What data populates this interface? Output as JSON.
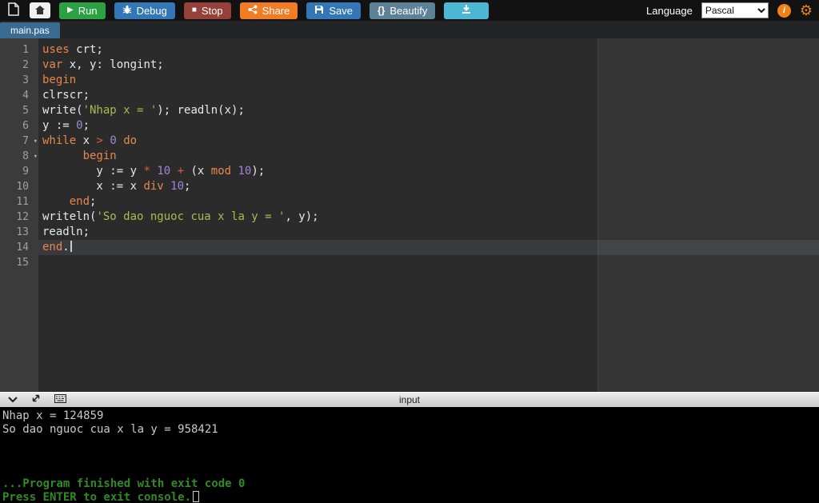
{
  "colors": {
    "run_button": "#2ba143",
    "debug_button": "#3377b6",
    "stop_button": "#95413a",
    "share_button": "#f07c24",
    "save_button": "#3377b6",
    "beautify_button": "#5d8196",
    "download_button": "#4cb8d5",
    "accent_orange": "#ef8318",
    "tab_active": "#3a6b93"
  },
  "toolbar": {
    "run": "Run",
    "debug": "Debug",
    "stop": "Stop",
    "share": "Share",
    "save": "Save",
    "beautify": "Beautify",
    "play_glyph": "▶",
    "stop_glyph": "■",
    "braces_glyph": "{}",
    "info_glyph": "i",
    "gear_glyph": "⚙",
    "language_label": "Language",
    "language_value": "Pascal"
  },
  "tabs": [
    {
      "label": "main.pas"
    }
  ],
  "editor": {
    "fold_glyph": "▾",
    "token_colors": {
      "kw": "#e8874a",
      "str": "#a8bc4f",
      "num": "#a184d9",
      "op": "#e8534a",
      "pl": "#e8e8ea"
    },
    "lines": [
      {
        "n": 1,
        "tokens": [
          [
            "kw",
            "uses"
          ],
          [
            "pl",
            " crt;"
          ]
        ]
      },
      {
        "n": 2,
        "tokens": [
          [
            "kw",
            "var"
          ],
          [
            "pl",
            " x, y: longint;"
          ]
        ]
      },
      {
        "n": 3,
        "tokens": [
          [
            "kw",
            "begin"
          ]
        ]
      },
      {
        "n": 4,
        "tokens": [
          [
            "pl",
            "clrscr;"
          ]
        ]
      },
      {
        "n": 5,
        "tokens": [
          [
            "pl",
            "write("
          ],
          [
            "str",
            "'Nhap x = '"
          ],
          [
            "pl",
            "); readln(x);"
          ]
        ]
      },
      {
        "n": 6,
        "tokens": [
          [
            "pl",
            "y := "
          ],
          [
            "num",
            "0"
          ],
          [
            "pl",
            ";"
          ]
        ]
      },
      {
        "n": 7,
        "fold": true,
        "tokens": [
          [
            "kw",
            "while"
          ],
          [
            "pl",
            " x "
          ],
          [
            "op",
            ">"
          ],
          [
            "pl",
            " "
          ],
          [
            "num",
            "0"
          ],
          [
            "pl",
            " "
          ],
          [
            "kw",
            "do"
          ]
        ]
      },
      {
        "n": 8,
        "fold": true,
        "tokens": [
          [
            "pl",
            "      "
          ],
          [
            "kw",
            "begin"
          ]
        ]
      },
      {
        "n": 9,
        "tokens": [
          [
            "pl",
            "        y := y "
          ],
          [
            "op",
            "*"
          ],
          [
            "pl",
            " "
          ],
          [
            "num",
            "10"
          ],
          [
            "pl",
            " "
          ],
          [
            "op",
            "+"
          ],
          [
            "pl",
            " (x "
          ],
          [
            "kw",
            "mod"
          ],
          [
            "pl",
            " "
          ],
          [
            "num",
            "10"
          ],
          [
            "pl",
            ");"
          ]
        ]
      },
      {
        "n": 10,
        "tokens": [
          [
            "pl",
            "        x := x "
          ],
          [
            "kw",
            "div"
          ],
          [
            "pl",
            " "
          ],
          [
            "num",
            "10"
          ],
          [
            "pl",
            ";"
          ]
        ]
      },
      {
        "n": 11,
        "tokens": [
          [
            "pl",
            "    "
          ],
          [
            "kw",
            "end"
          ],
          [
            "pl",
            ";"
          ]
        ]
      },
      {
        "n": 12,
        "tokens": [
          [
            "pl",
            "writeln("
          ],
          [
            "str",
            "'So dao nguoc cua x la y = '"
          ],
          [
            "pl",
            ", y);"
          ]
        ]
      },
      {
        "n": 13,
        "tokens": [
          [
            "pl",
            "readln;"
          ]
        ]
      },
      {
        "n": 14,
        "active": true,
        "cursor": true,
        "tokens": [
          [
            "kw",
            "end"
          ],
          [
            "pl",
            "."
          ]
        ]
      },
      {
        "n": 15,
        "tokens": []
      }
    ]
  },
  "console": {
    "input_label": "input",
    "colors": {
      "plain": "#c9c9c9",
      "status": "#2f8b24"
    },
    "lines": [
      {
        "style": "plain",
        "text": "Nhap x = 124859"
      },
      {
        "style": "plain",
        "text": "So dao nguoc cua x la y = 958421"
      },
      {
        "style": "plain",
        "text": ""
      },
      {
        "style": "plain",
        "text": ""
      },
      {
        "style": "plain",
        "text": ""
      },
      {
        "style": "status",
        "text": "...Program finished with exit code 0"
      },
      {
        "style": "status",
        "text": "Press ENTER to exit console.",
        "cursor": true
      }
    ]
  }
}
